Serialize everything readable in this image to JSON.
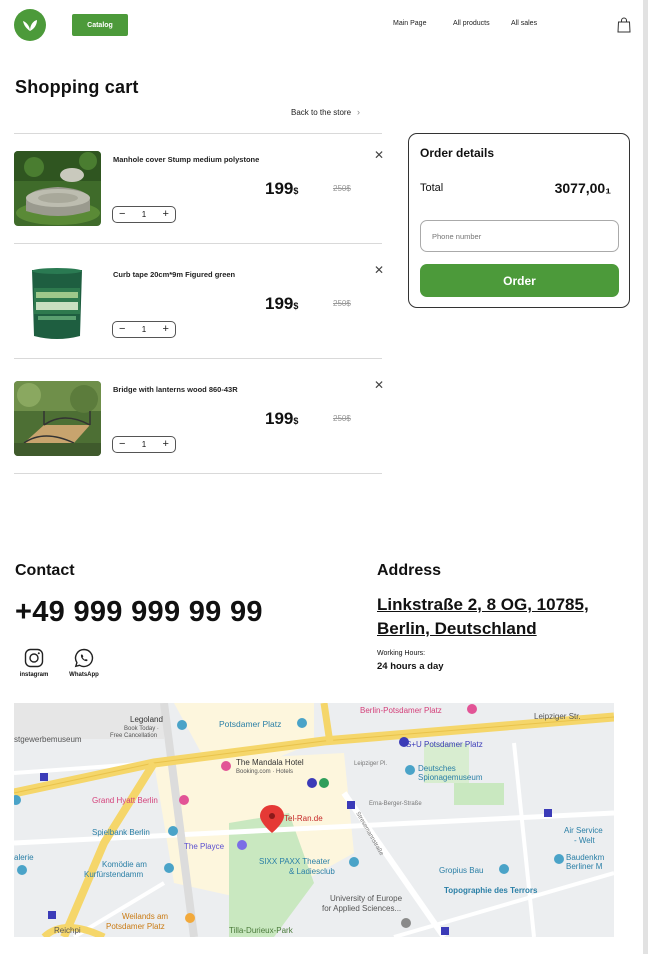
{
  "header": {
    "catalog_label": "Catalog",
    "nav": [
      "Main Page",
      "All products",
      "All sales"
    ]
  },
  "cart": {
    "title": "Shopping cart",
    "back_label": "Back to the store",
    "items": [
      {
        "name": "Manhole cover Stump medium polystone",
        "price": "199",
        "currency": "$",
        "old_price": "250$",
        "qty": "1"
      },
      {
        "name": "Curb tape 20cm*9m Figured green",
        "price": "199",
        "currency": "$",
        "old_price": "250$",
        "qty": "1"
      },
      {
        "name": "Bridge with lanterns wood 860-43R",
        "price": "199",
        "currency": "$",
        "old_price": "250$",
        "qty": "1"
      }
    ]
  },
  "order": {
    "title": "Order details",
    "total_label": "Total",
    "total_value": "3077,00₁",
    "phone_placeholder": "Phone number",
    "order_label": "Order"
  },
  "contact": {
    "title": "Contact",
    "phone": "+49 999 999 99 99",
    "social": [
      {
        "icon": "instagram-icon",
        "label": "instagram"
      },
      {
        "icon": "whatsapp-icon",
        "label": "WhatsApp"
      }
    ]
  },
  "address": {
    "title": "Address",
    "line1": "Linkstraße 2, 8 OG, 10785,",
    "line2": "Berlin, Deutschland",
    "hours_label": "Working Hours:",
    "hours_value": "24 hours a day"
  },
  "map": {
    "labels": {
      "legoland": "Legoland",
      "book_today": "Book Today ·",
      "free_cancel": "Free Cancellation",
      "potsdamer_platz": "Potsdamer Platz",
      "berlin_potsdamer": "Berlin-Potsdamer Platz",
      "leipziger": "Leipziger Str.",
      "kunstgewerbe": "stgewerbemuseum",
      "su_potsdamer": "S+U Potsdamer Platz",
      "mandala": "The Mandala Hotel",
      "booking": "Booking.com · Hotels",
      "leipziger_pl": "Leipziger Pl.",
      "spionage1": "Deutsches",
      "spionage2": "Spionagemuseum",
      "grand_hyatt": "Grand Hyatt Berlin",
      "erna_berger": "Erna-Berger-Straße",
      "telran": "Tel-Ran.de",
      "spielbank": "Spielbank Berlin",
      "stresemann": "Stresemannstraße",
      "air_service1": "Air Service",
      "air_service2": "- Welt",
      "playce": "The Playce",
      "galerie": "alerie",
      "komodie1": "Komödie am",
      "komodie2": "Kurfürstendamm",
      "sixx1": "SIXX PAXX Theater",
      "sixx2": "& Ladiesclub",
      "gropius": "Gropius Bau",
      "baudenkm1": "Baudenkm",
      "baudenkm2": "Berliner M",
      "topographie": "Topographie des Terrors",
      "university1": "University of Europe",
      "university2": "for Applied Sciences...",
      "weilands1": "Weilands am",
      "weilands2": "Potsdamer Platz",
      "reichpi": "Reichpi",
      "tilla": "Tilla-Durieux-Park"
    }
  }
}
